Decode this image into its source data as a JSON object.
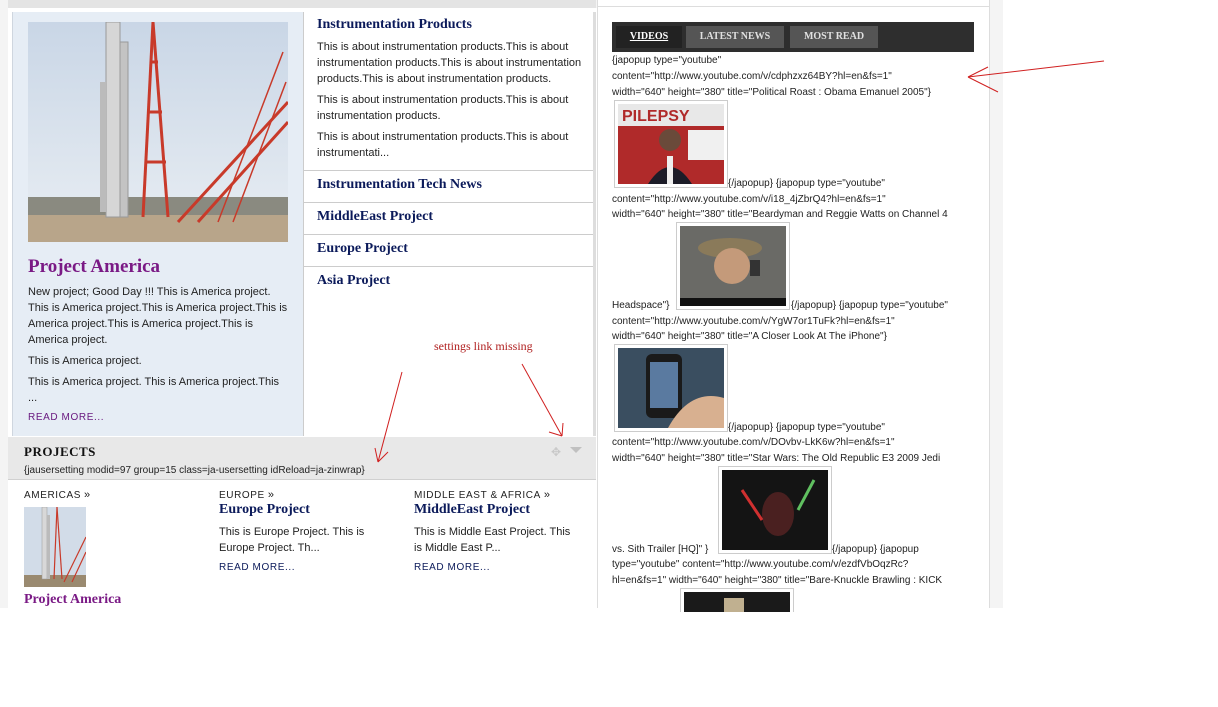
{
  "featured": {
    "title": "Project America",
    "paragraphs": [
      " New project; Good Day !!! This is America project. This is America project.This is America project.This is America project.This is America project.This is America project.",
      "This is America project.",
      "This is America project. This is America project.This ..."
    ],
    "read_more": "READ MORE..."
  },
  "list": {
    "items": [
      {
        "title": "Instrumentation Products"
      },
      {
        "title": "Instrumentation Tech News"
      },
      {
        "title": "MiddleEast Project"
      },
      {
        "title": "Europe Project"
      },
      {
        "title": "Asia Project"
      }
    ],
    "desc": [
      "This is about instrumentation products.This is about instrumentation products.This is about instrumentation products.This is about instrumentation products.",
      "This is about instrumentation products.This is about instrumentation products.",
      "This is about instrumentation products.This is about instrumentati..."
    ]
  },
  "projects": {
    "title": "PROJECTS",
    "setting": "{jausersetting modid=97 group=15 class=ja-usersetting idReload=ja-zinwrap}",
    "columns": [
      {
        "category": "AMERICAS",
        "title": "Project America",
        "desc": "",
        "read_more": ""
      },
      {
        "category": "EUROPE",
        "title": "Europe Project",
        "desc": "This is Europe Project. This is Europe Project. Th...",
        "read_more": "READ MORE..."
      },
      {
        "category": "MIDDLE EAST & AFRICA",
        "title": "MiddleEast Project",
        "desc": "This is Middle East Project. This is Middle East P...",
        "read_more": "READ MORE..."
      }
    ]
  },
  "tabs": [
    {
      "label": "VIDEOS",
      "active": true
    },
    {
      "label": "LATEST NEWS",
      "active": false
    },
    {
      "label": "MOST READ",
      "active": false
    }
  ],
  "videos": {
    "lines": [
      "{japopup type=\"youtube\"",
      "content=\"http://www.youtube.com/v/cdphzxz64BY?hl=en&fs=1\"",
      "width=\"640\" height=\"380\" title=\"Political Roast : Obama Emanuel 2005\"}",
      "{/japopup} {japopup type=\"youtube\"",
      "content=\"http://www.youtube.com/v/i18_4jZbrQ4?hl=en&fs=1\"",
      "width=\"640\" height=\"380\" title=\"Beardyman and Reggie Watts on Channel 4",
      "Headspace\"}",
      "{/japopup} {japopup type=\"youtube\"",
      "content=\"http://www.youtube.com/v/YgW7or1TuFk?hl=en&fs=1\"",
      "width=\"640\" height=\"380\" title=\"A Closer Look At The iPhone\"}",
      "{/japopup} {japopup type=\"youtube\"",
      "content=\"http://www.youtube.com/v/DOvbv-LkK6w?hl=en&fs=1\"",
      "width=\"640\" height=\"380\" title=\"Star Wars: The Old Republic E3 2009 Jedi",
      "vs. Sith Trailer [HQ]\" }",
      "{/japopup} {japopup",
      "type=\"youtube\" content=\"http://www.youtube.com/v/ezdfVbOqzRc?",
      "hl=en&fs=1\" width=\"640\" height=\"380\" title=\"Bare-Knuckle Brawling : KICK"
    ]
  },
  "annotations": {
    "settings_missing": "settings link missing"
  },
  "colors": {
    "annotation": "#b02020",
    "link_dark": "#0b1a5a",
    "link_purple": "#7a1a85",
    "tab_bar": "#2e2e2e"
  }
}
